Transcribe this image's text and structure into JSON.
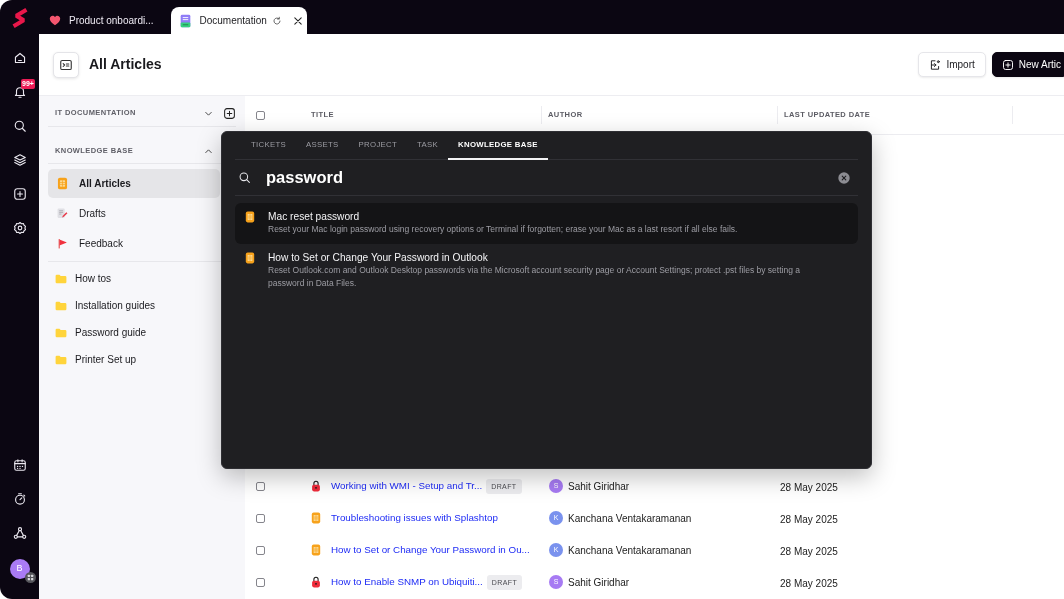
{
  "rail": {
    "notification_badge": "99+",
    "avatar_initial": "B"
  },
  "tabs": [
    {
      "label": "Product onboardi...",
      "kind": "heart",
      "selected": false,
      "loading": false
    },
    {
      "label": "Documentation",
      "kind": "document",
      "selected": true,
      "loading": true
    }
  ],
  "header": {
    "title": "All Articles",
    "buttons": [
      {
        "label": "Import",
        "kind": "import"
      },
      {
        "label": "New Artic",
        "kind": "new"
      }
    ]
  },
  "sidebar": {
    "sections": [
      {
        "title": "IT DOCUMENTATION",
        "expanded": false
      },
      {
        "title": "KNOWLEDGE BASE",
        "expanded": true,
        "items": [
          {
            "label": "All Articles",
            "kind": "articles",
            "selected": true
          },
          {
            "label": "Drafts",
            "kind": "drafts",
            "selected": false
          },
          {
            "label": "Feedback",
            "kind": "feedback",
            "selected": false
          }
        ]
      }
    ],
    "folders": [
      {
        "label": "How tos"
      },
      {
        "label": "Installation guides"
      },
      {
        "label": "Password guide"
      },
      {
        "label": "Printer Set up"
      }
    ]
  },
  "table": {
    "select_all_checked": false,
    "columns": [
      "TITLE",
      "AUTHOR",
      "LAST UPDATED DATE"
    ],
    "rows": [
      {
        "checked": false,
        "kind": "locked",
        "title": "Working with WMI - Setup and Tr...",
        "badge": "DRAFT",
        "author": {
          "initial": "S",
          "name": "Sahit Giridhar",
          "color": "#a77bf3"
        },
        "updated": "28 May 2025"
      },
      {
        "checked": false,
        "kind": "article",
        "title": "Troubleshooting issues with Splashtop",
        "author": {
          "initial": "K",
          "name": "Kanchana Ventakaramanan",
          "color": "#7a92ee"
        },
        "updated": "28 May 2025"
      },
      {
        "checked": false,
        "kind": "article",
        "title": "How to Set or Change Your Password in Ou...",
        "author": {
          "initial": "K",
          "name": "Kanchana Ventakaramanan",
          "color": "#7a92ee"
        },
        "updated": "28 May 2025"
      },
      {
        "checked": false,
        "kind": "locked",
        "title": "How to Enable SNMP on Ubiquiti...",
        "badge": "DRAFT",
        "author": {
          "initial": "S",
          "name": "Sahit Giridhar",
          "color": "#a77bf3"
        },
        "updated": "28 May 2025"
      }
    ]
  },
  "search": {
    "tabs": [
      {
        "label": "TICKETS",
        "selected": false
      },
      {
        "label": "ASSETS",
        "selected": false
      },
      {
        "label": "PROJECT",
        "selected": false
      },
      {
        "label": "TASK",
        "selected": false
      },
      {
        "label": "KNOWLEDGE BASE",
        "selected": true
      }
    ],
    "query": "password",
    "results": [
      {
        "title": "Mac reset password",
        "description": "Reset your Mac login password using recovery options or Terminal if forgotten; erase your Mac as a last resort if all else fails.",
        "selected": true
      },
      {
        "title": "How to Set or Change Your Password in Outlook",
        "description": "Reset Outlook.com and Outlook Desktop passwords via the Microsoft account security page or Account Settings; protect .pst files by setting a password in Data Files.",
        "selected": false
      }
    ]
  }
}
